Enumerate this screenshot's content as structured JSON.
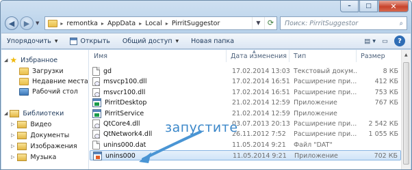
{
  "address": {
    "crumbs": [
      "remontka",
      "AppData",
      "Local",
      "PirritSuggestor"
    ],
    "search_placeholder": "Поиск: PirritSuggestor"
  },
  "toolbar": {
    "organize": "Упорядочить",
    "open": "Открыть",
    "share": "Общий доступ",
    "new_folder": "Новая папка"
  },
  "nav": {
    "favorites": "Избранное",
    "downloads": "Загрузки",
    "recent": "Недавние места",
    "desktop": "Рабочий стол",
    "libraries": "Библиотеки",
    "video": "Видео",
    "documents": "Документы",
    "images": "Изображения",
    "music": "Музыка"
  },
  "columns": {
    "name": "Имя",
    "date": "Дата изменения",
    "type": "Тип",
    "size": "Размер"
  },
  "files": [
    {
      "name": "gd",
      "date": "17.02.2014 13:03",
      "type": "Текстовый докум...",
      "size": "8 КБ",
      "icon": "text-file-icon"
    },
    {
      "name": "msvcp100.dll",
      "date": "17.02.2014 16:51",
      "type": "Расширение при...",
      "size": "412 КБ",
      "icon": "dll-file-icon"
    },
    {
      "name": "msvcr100.dll",
      "date": "17.02.2014 16:51",
      "type": "Расширение при...",
      "size": "753 КБ",
      "icon": "dll-file-icon"
    },
    {
      "name": "PirritDesktop",
      "date": "21.02.2014 12:59",
      "type": "Приложение",
      "size": "767 КБ",
      "icon": "app-icon"
    },
    {
      "name": "PirritService",
      "date": "21.02.2014 12:59",
      "type": "Приложение",
      "size": "",
      "icon": "app-icon"
    },
    {
      "name": "QtCore4.dll",
      "date": "03.07.2013 20:13",
      "type": "Расширение при...",
      "size": "2 542 КБ",
      "icon": "dll-file-icon"
    },
    {
      "name": "QtNetwork4.dll",
      "date": "26.11.2012 7:52",
      "type": "Расширение при...",
      "size": "1 055 КБ",
      "icon": "dll-file-icon"
    },
    {
      "name": "unins000.dat",
      "date": "11.05.2014 9:21",
      "type": "Файл \"DAT\"",
      "size": "",
      "icon": "text-file-icon"
    },
    {
      "name": "unins000",
      "date": "11.05.2014 9:21",
      "type": "Приложение",
      "size": "702 КБ",
      "icon": "setup-icon"
    }
  ],
  "annotation": "запустите",
  "colors": {
    "accent": "#3b87c9",
    "selection": "#cfe4f8"
  }
}
